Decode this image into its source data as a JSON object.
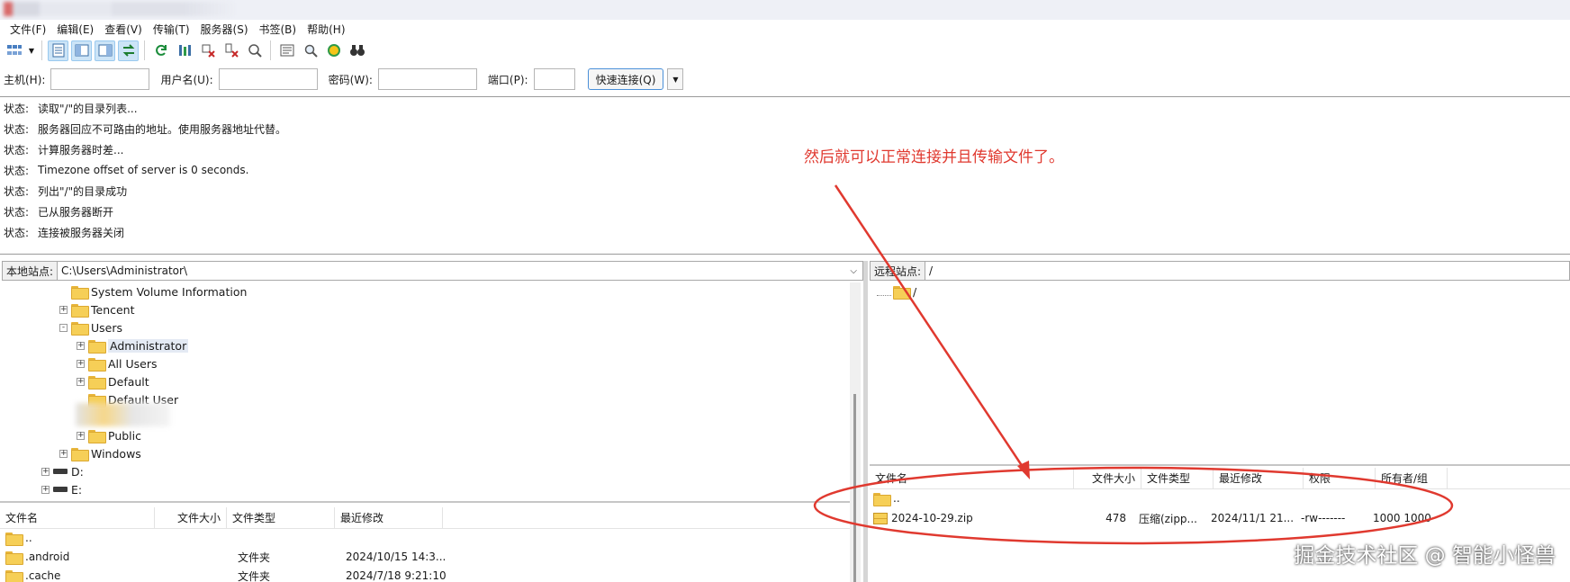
{
  "menubar": {
    "items": [
      "文件(F)",
      "编辑(E)",
      "查看(V)",
      "传输(T)",
      "服务器(S)",
      "书签(B)",
      "帮助(H)"
    ]
  },
  "quickconnect": {
    "host_label": "主机(H):",
    "user_label": "用户名(U):",
    "password_label": "密码(W):",
    "port_label": "端口(P):",
    "connect_button": "快速连接(Q)"
  },
  "log": {
    "entries": [
      {
        "label": "状态:",
        "text": "读取\"/\"的目录列表..."
      },
      {
        "label": "状态:",
        "text": "服务器回应不可路由的地址。使用服务器地址代替。"
      },
      {
        "label": "状态:",
        "text": "计算服务器时差..."
      },
      {
        "label": "状态:",
        "text": "Timezone offset of server is 0 seconds."
      },
      {
        "label": "状态:",
        "text": "列出\"/\"的目录成功"
      },
      {
        "label": "状态:",
        "text": "已从服务器断开"
      },
      {
        "label": "状态:",
        "text": "连接被服务器关闭"
      }
    ]
  },
  "annotation": {
    "text": "然后就可以正常连接并且传输文件了。",
    "color": "#e0392f"
  },
  "local": {
    "site_label": "本地站点:",
    "path": "C:\\Users\\Administrator\\",
    "tree": [
      {
        "label": "System Volume Information",
        "expander": "",
        "kind": "folder"
      },
      {
        "label": "Tencent",
        "expander": "+",
        "kind": "folder"
      },
      {
        "label": "Users",
        "expander": "-",
        "kind": "folder"
      },
      {
        "label": "Administrator",
        "expander": "+",
        "kind": "folder"
      },
      {
        "label": "All Users",
        "expander": "+",
        "kind": "folder"
      },
      {
        "label": "Default",
        "expander": "+",
        "kind": "folder"
      },
      {
        "label": "Default User",
        "expander": "",
        "kind": "folder"
      },
      {
        "label": "Public",
        "expander": "+",
        "kind": "folder"
      },
      {
        "label": "Windows",
        "expander": "+",
        "kind": "folder"
      },
      {
        "label": "D:",
        "expander": "+",
        "kind": "drive"
      },
      {
        "label": "E:",
        "expander": "+",
        "kind": "drive"
      }
    ],
    "columns": [
      "文件名",
      "文件大小",
      "文件类型",
      "最近修改"
    ],
    "rows": [
      {
        "name": "..",
        "size": "",
        "type": "",
        "modified": ""
      },
      {
        "name": ".android",
        "size": "",
        "type": "文件夹",
        "modified": "2024/10/15 14:3..."
      },
      {
        "name": ".cache",
        "size": "",
        "type": "文件夹",
        "modified": "2024/7/18 9:21:10"
      }
    ]
  },
  "remote": {
    "site_label": "远程站点:",
    "path": "/",
    "tree_root": "/",
    "columns": [
      "文件名",
      "文件大小",
      "文件类型",
      "最近修改",
      "权限",
      "所有者/组"
    ],
    "rows": [
      {
        "name": "..",
        "size": "",
        "type": "",
        "modified": "",
        "perm": "",
        "owner": ""
      },
      {
        "name": "2024-10-29.zip",
        "size": "478",
        "type": "压缩(zipp...",
        "modified": "2024/11/1 21...",
        "perm": "-rw-------",
        "owner": "1000 1000"
      }
    ]
  },
  "watermark": "掘金技术社区 @ 智能小怪兽"
}
